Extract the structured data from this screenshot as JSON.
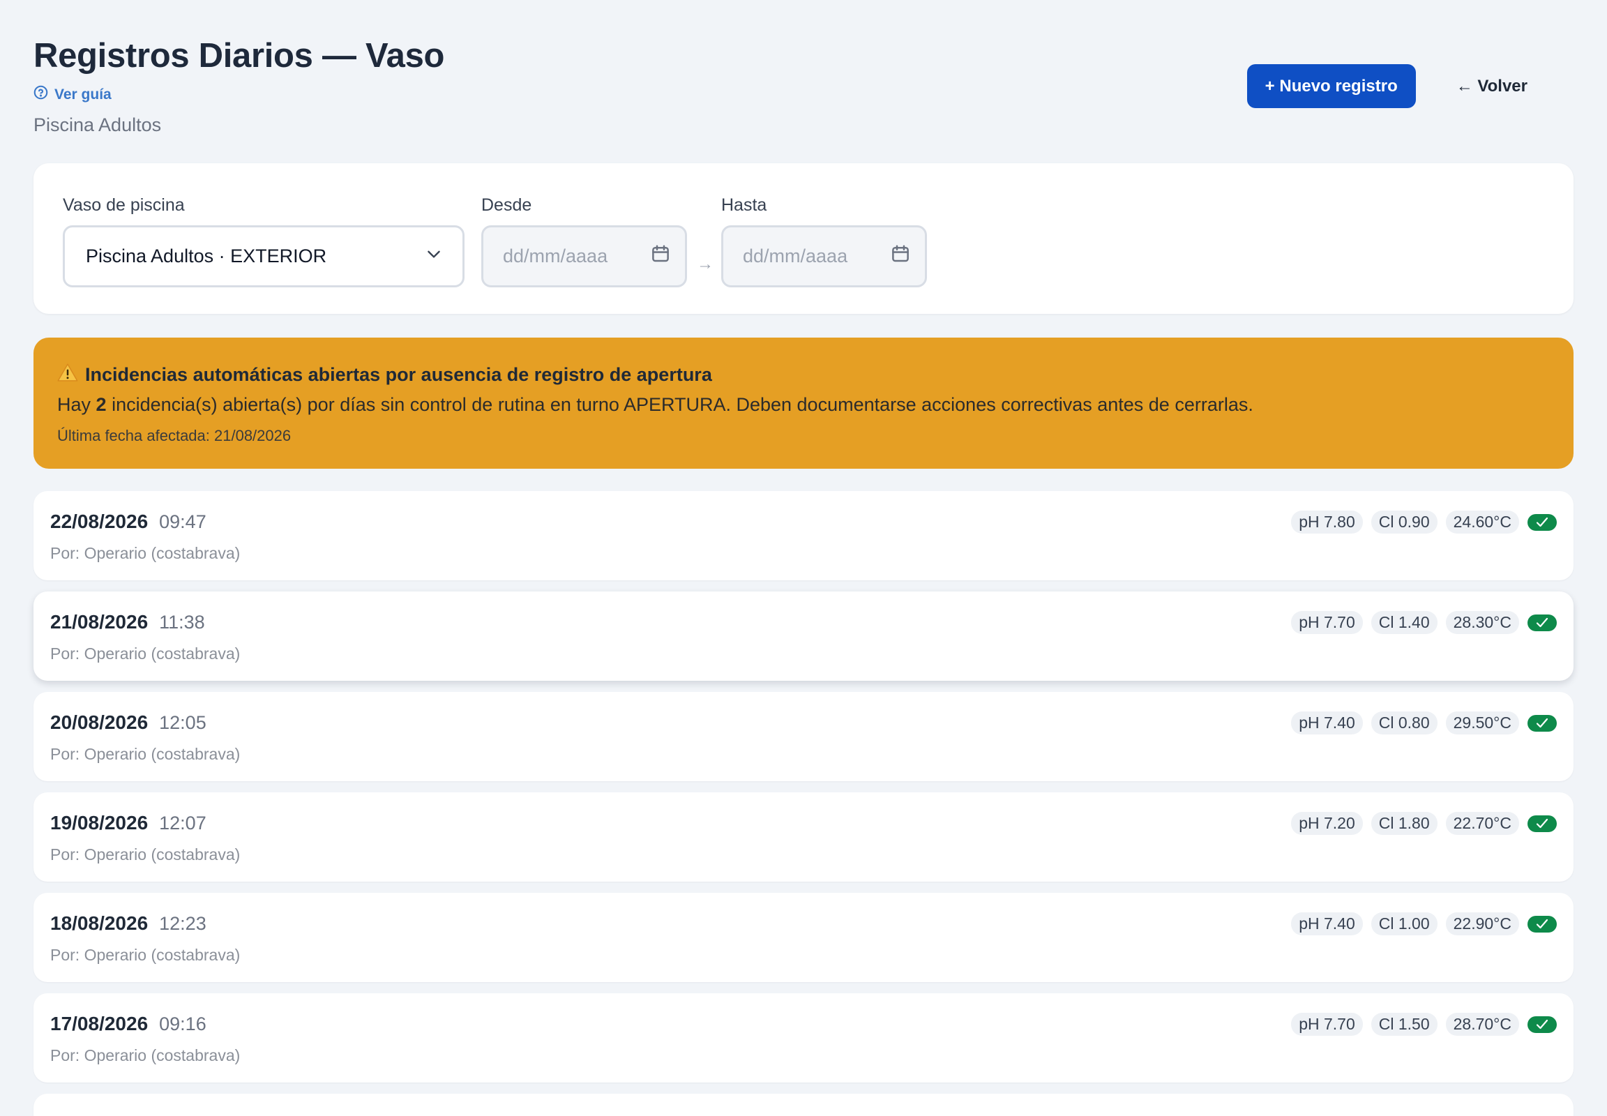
{
  "header": {
    "title": "Registros Diarios — Vaso",
    "guide_link": "Ver guía",
    "subtitle": "Piscina Adultos",
    "new_button": "+ Nuevo registro",
    "back_button": "← Volver"
  },
  "filters": {
    "pool_label": "Vaso de piscina",
    "pool_value": "Piscina Adultos · EXTERIOR",
    "from_label": "Desde",
    "from_placeholder": "dd/mm/aaaa",
    "range_arrow": "→",
    "to_label": "Hasta",
    "to_placeholder": "dd/mm/aaaa"
  },
  "alert": {
    "title": "Incidencias automáticas abiertas por ausencia de registro de apertura",
    "body_prefix": "Hay ",
    "count": "2",
    "body_suffix": " incidencia(s) abierta(s) por días sin control de rutina en turno APERTURA. Deben documentarse acciones correctivas antes de cerrarlas.",
    "footer": "Última fecha afectada: 21/08/2026"
  },
  "colors": {
    "primary": "#0f4fc4",
    "alert_bg": "#e59f24",
    "ok_badge": "#0e8a4a"
  },
  "records": [
    {
      "date": "22/08/2026",
      "time": "09:47",
      "by": "Por: Operario (costabrava)",
      "ph": "pH 7.80",
      "cl": "Cl 0.90",
      "temp": "24.60°C"
    },
    {
      "date": "21/08/2026",
      "time": "11:38",
      "by": "Por: Operario (costabrava)",
      "ph": "pH 7.70",
      "cl": "Cl 1.40",
      "temp": "28.30°C"
    },
    {
      "date": "20/08/2026",
      "time": "12:05",
      "by": "Por: Operario (costabrava)",
      "ph": "pH 7.40",
      "cl": "Cl 0.80",
      "temp": "29.50°C"
    },
    {
      "date": "19/08/2026",
      "time": "12:07",
      "by": "Por: Operario (costabrava)",
      "ph": "pH 7.20",
      "cl": "Cl 1.80",
      "temp": "22.70°C"
    },
    {
      "date": "18/08/2026",
      "time": "12:23",
      "by": "Por: Operario (costabrava)",
      "ph": "pH 7.40",
      "cl": "Cl 1.00",
      "temp": "22.90°C"
    },
    {
      "date": "17/08/2026",
      "time": "09:16",
      "by": "Por: Operario (costabrava)",
      "ph": "pH 7.70",
      "cl": "Cl 1.50",
      "temp": "28.70°C"
    }
  ]
}
